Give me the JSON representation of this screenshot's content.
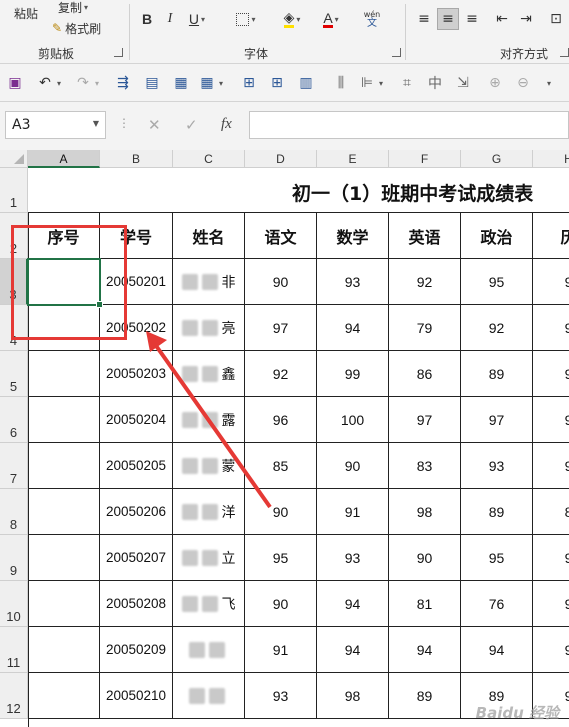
{
  "ribbon": {
    "clipboard": {
      "paste_label": "粘贴",
      "copy_label": "复制",
      "format_painter_label": "格式刷",
      "group_label": "剪贴板"
    },
    "font": {
      "group_label": "字体",
      "bold": "B",
      "italic": "I",
      "underline": "U",
      "font_color_glyph": "A",
      "phonetic_glyph": "wén"
    },
    "alignment": {
      "group_label": "对齐方式"
    }
  },
  "formula_bar": {
    "name_box": "A3",
    "fx": "fx",
    "cancel": "✕",
    "enter": "✓",
    "formula": ""
  },
  "sheet": {
    "column_headers": [
      "A",
      "B",
      "C",
      "D",
      "E",
      "F",
      "G",
      "H"
    ],
    "row_headers": [
      "1",
      "2",
      "3",
      "4",
      "5",
      "6",
      "7",
      "8",
      "9",
      "10",
      "11",
      "12"
    ],
    "title": "初一（1）班期中考试成绩表",
    "table_headers": [
      "序号",
      "学号",
      "姓名",
      "语文",
      "数学",
      "英语",
      "政治",
      "历"
    ],
    "rows": [
      {
        "seq": "",
        "id": "20050201",
        "name": "非",
        "chinese": "90",
        "math": "93",
        "english": "92",
        "politics": "95",
        "history": "9"
      },
      {
        "seq": "",
        "id": "20050202",
        "name": "亮",
        "chinese": "97",
        "math": "94",
        "english": "79",
        "politics": "92",
        "history": "9"
      },
      {
        "seq": "",
        "id": "20050203",
        "name": "鑫",
        "chinese": "92",
        "math": "99",
        "english": "86",
        "politics": "89",
        "history": "9"
      },
      {
        "seq": "",
        "id": "20050204",
        "name": "露",
        "chinese": "96",
        "math": "100",
        "english": "97",
        "politics": "97",
        "history": "9"
      },
      {
        "seq": "",
        "id": "20050205",
        "name": "蒙",
        "chinese": "85",
        "math": "90",
        "english": "83",
        "politics": "93",
        "history": "9"
      },
      {
        "seq": "",
        "id": "20050206",
        "name": "洋",
        "chinese": "90",
        "math": "91",
        "english": "98",
        "politics": "89",
        "history": "8"
      },
      {
        "seq": "",
        "id": "20050207",
        "name": "立",
        "chinese": "95",
        "math": "93",
        "english": "90",
        "politics": "95",
        "history": "9"
      },
      {
        "seq": "",
        "id": "20050208",
        "name": "飞",
        "chinese": "90",
        "math": "94",
        "english": "81",
        "politics": "76",
        "history": "9"
      },
      {
        "seq": "",
        "id": "20050209",
        "name": "",
        "chinese": "91",
        "math": "94",
        "english": "94",
        "politics": "94",
        "history": "9"
      },
      {
        "seq": "",
        "id": "20050210",
        "name": "",
        "chinese": "93",
        "math": "98",
        "english": "89",
        "politics": "89",
        "history": "9"
      }
    ]
  },
  "watermark": "Baidu 经验",
  "colors": {
    "selection": "#217346",
    "annotation": "#e53935"
  }
}
